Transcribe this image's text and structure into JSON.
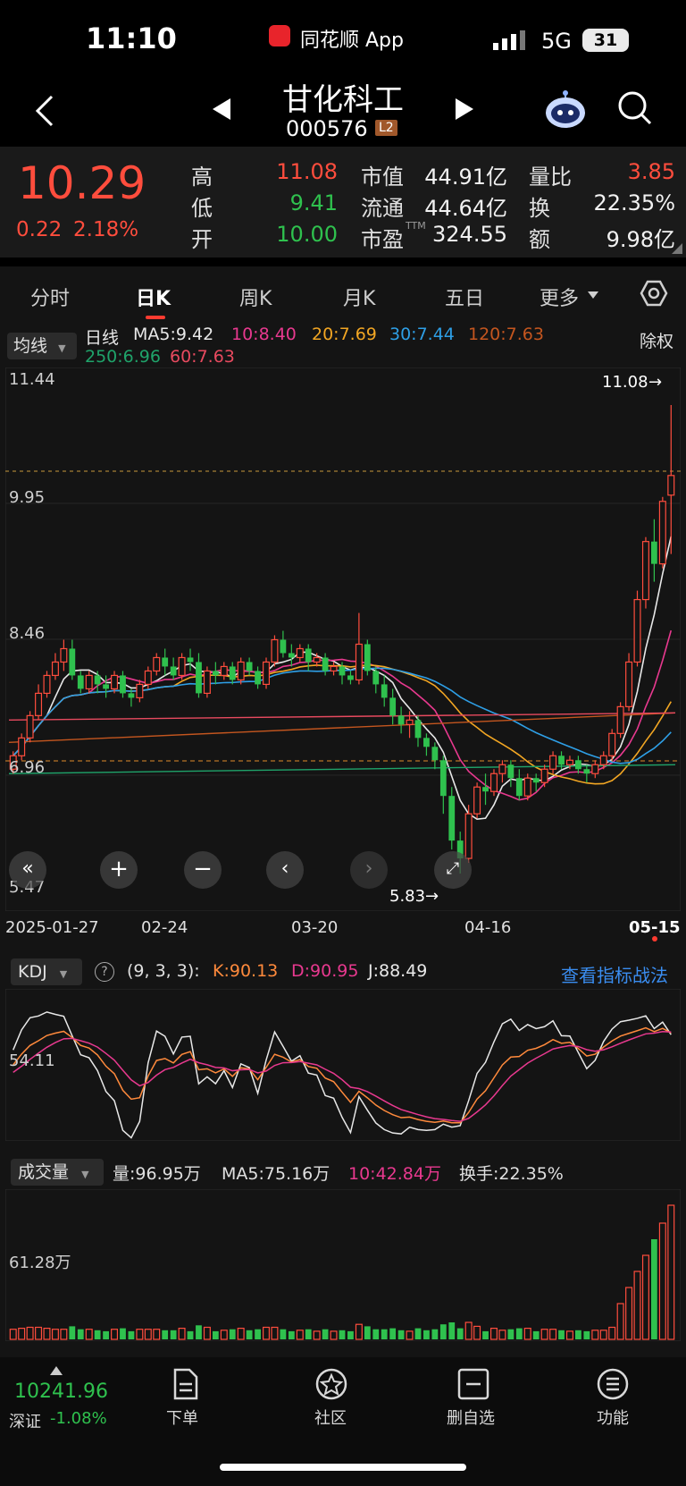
{
  "status": {
    "time": "11:10",
    "app": "同花顺 App",
    "network": "5G",
    "battery": "31"
  },
  "header": {
    "name": "甘化科工",
    "code": "000576",
    "level_badge": "L2"
  },
  "quote": {
    "price": "10.29",
    "change": "0.22",
    "change_pct": "2.18%",
    "rows": [
      {
        "l1": "高",
        "v1": "11.08",
        "c1": "#ff4d3d",
        "l2": "市值",
        "v2": "44.91亿",
        "l3": "量比",
        "v3": "3.85",
        "c3": "#ff4d3d"
      },
      {
        "l1": "低",
        "v1": "9.41",
        "c1": "#2fc14e",
        "l2": "流通",
        "v2": "44.64亿",
        "l3": "换",
        "v3": "22.35%",
        "c3": "#f2f2f2"
      },
      {
        "l1": "开",
        "v1": "10.00",
        "c1": "#2fc14e",
        "l2": "市盈",
        "v2": "324.55",
        "l3": "额",
        "v3": "9.98亿",
        "c3": "#f2f2f2"
      }
    ],
    "pe_superscript": "TTM"
  },
  "tabs": [
    "分时",
    "日K",
    "周K",
    "月K",
    "五日",
    "更多"
  ],
  "active_tab": "日K",
  "ma_legend": {
    "selector": "均线",
    "period": "日线",
    "right_label": "除权",
    "items": [
      {
        "text": "MA5:9.42",
        "color": "#e8e8e8"
      },
      {
        "text": "10:8.40",
        "color": "#e8398f"
      },
      {
        "text": "20:7.69",
        "color": "#f2a623"
      },
      {
        "text": "30:7.44",
        "color": "#2e9fe6"
      },
      {
        "text": "120:7.63",
        "color": "#c4561f"
      },
      {
        "text": "250:6.96",
        "color": "#1fa36a"
      },
      {
        "text": "60:7.63",
        "color": "#e84a5f"
      }
    ]
  },
  "price_axis": {
    "labels": [
      "11.44",
      "9.95",
      "8.46",
      "6.96",
      "5.47"
    ]
  },
  "annotations": {
    "high": "11.08",
    "low": "5.83"
  },
  "date_axis": [
    "2025-01-27",
    "02-24",
    "03-20",
    "04-16",
    "05-15"
  ],
  "chart_controls": [
    "collapse-left",
    "zoom-in",
    "zoom-out",
    "scroll-left",
    "scroll-right",
    "fullscreen"
  ],
  "chart_data": {
    "type": "candlestick",
    "y_range": [
      5.47,
      11.44
    ],
    "candles": [
      [
        7.0,
        7.15,
        6.95,
        7.2
      ],
      [
        7.15,
        7.35,
        7.1,
        7.4
      ],
      [
        7.35,
        7.6,
        7.3,
        7.65
      ],
      [
        7.6,
        7.85,
        7.55,
        7.95
      ],
      [
        7.85,
        8.05,
        7.8,
        8.1
      ],
      [
        8.05,
        8.2,
        8.0,
        8.3
      ],
      [
        8.2,
        8.35,
        8.1,
        8.45
      ],
      [
        8.35,
        8.05,
        8.0,
        8.45
      ],
      [
        8.05,
        7.9,
        7.85,
        8.1
      ],
      [
        7.9,
        8.05,
        7.85,
        8.1
      ],
      [
        8.05,
        7.95,
        7.85,
        8.1
      ],
      [
        7.95,
        7.9,
        7.8,
        8.05
      ],
      [
        7.9,
        8.05,
        7.85,
        8.1
      ],
      [
        8.05,
        7.85,
        7.8,
        8.1
      ],
      [
        7.85,
        7.8,
        7.7,
        7.9
      ],
      [
        7.8,
        7.95,
        7.75,
        8.0
      ],
      [
        7.95,
        8.1,
        7.9,
        8.15
      ],
      [
        8.1,
        8.25,
        8.05,
        8.3
      ],
      [
        8.25,
        8.15,
        8.05,
        8.35
      ],
      [
        8.15,
        8.05,
        8.0,
        8.25
      ],
      [
        8.05,
        8.25,
        8.0,
        8.3
      ],
      [
        8.25,
        8.2,
        8.1,
        8.35
      ],
      [
        8.2,
        7.85,
        7.8,
        8.3
      ],
      [
        7.85,
        8.1,
        7.8,
        8.15
      ],
      [
        8.1,
        8.05,
        7.95,
        8.2
      ],
      [
        8.05,
        8.15,
        8.0,
        8.2
      ],
      [
        8.15,
        8.0,
        7.95,
        8.2
      ],
      [
        8.0,
        8.2,
        7.95,
        8.25
      ],
      [
        8.2,
        8.1,
        8.05,
        8.25
      ],
      [
        8.1,
        7.95,
        7.9,
        8.15
      ],
      [
        7.95,
        8.2,
        7.9,
        8.25
      ],
      [
        8.2,
        8.45,
        8.15,
        8.5
      ],
      [
        8.45,
        8.3,
        8.25,
        8.55
      ],
      [
        8.3,
        8.25,
        8.15,
        8.4
      ],
      [
        8.25,
        8.35,
        8.2,
        8.4
      ],
      [
        8.35,
        8.2,
        8.1,
        8.4
      ],
      [
        8.2,
        8.25,
        8.15,
        8.3
      ],
      [
        8.25,
        8.1,
        8.05,
        8.3
      ],
      [
        8.1,
        8.15,
        8.05,
        8.2
      ],
      [
        8.15,
        8.05,
        7.95,
        8.2
      ],
      [
        8.05,
        8.0,
        7.95,
        8.1
      ],
      [
        8.0,
        8.4,
        7.95,
        8.75
      ],
      [
        8.4,
        8.1,
        8.05,
        8.45
      ],
      [
        8.1,
        7.95,
        7.85,
        8.15
      ],
      [
        7.95,
        7.8,
        7.7,
        8.05
      ],
      [
        7.8,
        7.6,
        7.5,
        7.9
      ],
      [
        7.6,
        7.5,
        7.4,
        7.7
      ],
      [
        7.5,
        7.55,
        7.35,
        7.65
      ],
      [
        7.55,
        7.35,
        7.25,
        7.6
      ],
      [
        7.35,
        7.25,
        7.15,
        7.4
      ],
      [
        7.25,
        7.1,
        7.0,
        7.3
      ],
      [
        7.1,
        6.7,
        6.5,
        7.15
      ],
      [
        6.7,
        6.2,
        6.1,
        6.8
      ],
      [
        6.2,
        6.0,
        5.83,
        6.3
      ],
      [
        6.0,
        6.5,
        5.95,
        6.6
      ],
      [
        6.5,
        6.8,
        6.45,
        6.85
      ],
      [
        6.8,
        6.75,
        6.6,
        6.95
      ],
      [
        6.75,
        6.95,
        6.7,
        7.0
      ],
      [
        6.95,
        7.05,
        6.85,
        7.1
      ],
      [
        7.05,
        6.9,
        6.8,
        7.1
      ],
      [
        6.9,
        6.7,
        6.65,
        7.0
      ],
      [
        6.7,
        6.9,
        6.65,
        6.95
      ],
      [
        6.9,
        6.85,
        6.75,
        6.95
      ],
      [
        6.85,
        7.0,
        6.8,
        7.05
      ],
      [
        7.0,
        7.15,
        6.95,
        7.2
      ],
      [
        7.15,
        7.05,
        7.0,
        7.2
      ],
      [
        7.05,
        7.1,
        7.0,
        7.15
      ],
      [
        7.1,
        7.0,
        6.95,
        7.15
      ],
      [
        7.0,
        6.95,
        6.85,
        7.05
      ],
      [
        6.95,
        7.05,
        6.9,
        7.1
      ],
      [
        7.05,
        7.15,
        7.0,
        7.2
      ],
      [
        7.15,
        7.4,
        7.1,
        7.45
      ],
      [
        7.4,
        7.7,
        7.35,
        7.75
      ],
      [
        7.7,
        8.2,
        7.65,
        8.3
      ],
      [
        8.2,
        8.9,
        8.15,
        9.0
      ],
      [
        8.9,
        9.55,
        8.8,
        9.6
      ],
      [
        9.55,
        9.3,
        9.1,
        9.8
      ],
      [
        9.3,
        10.0,
        9.25,
        10.05
      ],
      [
        10.07,
        10.29,
        9.41,
        11.08
      ]
    ]
  },
  "kdj": {
    "selector": "KDJ",
    "params": "(9, 3, 3):",
    "k": "K:90.13",
    "d": "D:90.95",
    "j": "J:88.49",
    "level": "54.11",
    "link": "查看指标战法"
  },
  "volume": {
    "selector": "成交量",
    "amount": "量:96.95万",
    "ma5": "MA5:75.16万",
    "ma10": "10:42.84万",
    "turnover": "换手:22.35%",
    "level": "61.28万"
  },
  "bottom_nav": {
    "index_value": "10241.96",
    "index_name": "深证",
    "index_change": "-1.08%",
    "items": [
      "下单",
      "社区",
      "删自选",
      "功能"
    ]
  },
  "colors": {
    "up": "#ff4d3d",
    "down": "#2fc14e",
    "panel": "#1a1a1a"
  }
}
